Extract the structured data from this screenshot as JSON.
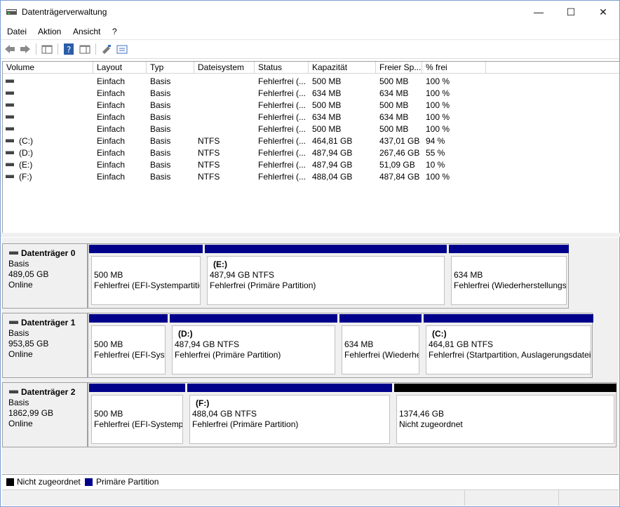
{
  "window": {
    "title": "Datenträgerverwaltung",
    "minimize": "—",
    "maximize": "☐",
    "close": "✕"
  },
  "menu": [
    "Datei",
    "Aktion",
    "Ansicht",
    "?"
  ],
  "columns": [
    "Volume",
    "Layout",
    "Typ",
    "Dateisystem",
    "Status",
    "Kapazität",
    "Freier Sp...",
    "% frei"
  ],
  "volumes": [
    {
      "name": "",
      "layout": "Einfach",
      "typ": "Basis",
      "fs": "",
      "status": "Fehlerfrei (...",
      "cap": "500 MB",
      "free": "500 MB",
      "pct": "100 %"
    },
    {
      "name": "",
      "layout": "Einfach",
      "typ": "Basis",
      "fs": "",
      "status": "Fehlerfrei (...",
      "cap": "634 MB",
      "free": "634 MB",
      "pct": "100 %"
    },
    {
      "name": "",
      "layout": "Einfach",
      "typ": "Basis",
      "fs": "",
      "status": "Fehlerfrei (...",
      "cap": "500 MB",
      "free": "500 MB",
      "pct": "100 %"
    },
    {
      "name": "",
      "layout": "Einfach",
      "typ": "Basis",
      "fs": "",
      "status": "Fehlerfrei (...",
      "cap": "634 MB",
      "free": "634 MB",
      "pct": "100 %"
    },
    {
      "name": "",
      "layout": "Einfach",
      "typ": "Basis",
      "fs": "",
      "status": "Fehlerfrei (...",
      "cap": "500 MB",
      "free": "500 MB",
      "pct": "100 %"
    },
    {
      "name": "(C:)",
      "layout": "Einfach",
      "typ": "Basis",
      "fs": "NTFS",
      "status": "Fehlerfrei (...",
      "cap": "464,81 GB",
      "free": "437,01 GB",
      "pct": "94 %"
    },
    {
      "name": "(D:)",
      "layout": "Einfach",
      "typ": "Basis",
      "fs": "NTFS",
      "status": "Fehlerfrei (...",
      "cap": "487,94 GB",
      "free": "267,46 GB",
      "pct": "55 %"
    },
    {
      "name": "(E:)",
      "layout": "Einfach",
      "typ": "Basis",
      "fs": "NTFS",
      "status": "Fehlerfrei (...",
      "cap": "487,94 GB",
      "free": "51,09 GB",
      "pct": "10 %"
    },
    {
      "name": "(F:)",
      "layout": "Einfach",
      "typ": "Basis",
      "fs": "NTFS",
      "status": "Fehlerfrei (...",
      "cap": "488,04 GB",
      "free": "487,84 GB",
      "pct": "100 %"
    }
  ],
  "disks": [
    {
      "name": "Datenträger 0",
      "type": "Basis",
      "size": "489,05 GB",
      "state": "Online",
      "parts": [
        {
          "label": "",
          "size": "500 MB",
          "status": "Fehlerfrei (EFI-Systempartition)",
          "kind": "primary"
        },
        {
          "label": "(E:)",
          "size": "487,94 GB NTFS",
          "status": "Fehlerfrei (Primäre Partition)",
          "kind": "primary"
        },
        {
          "label": "",
          "size": "634 MB",
          "status": "Fehlerfrei (Wiederherstellungspartition)",
          "kind": "primary"
        }
      ]
    },
    {
      "name": "Datenträger 1",
      "type": "Basis",
      "size": "953,85 GB",
      "state": "Online",
      "parts": [
        {
          "label": "",
          "size": "500 MB",
          "status": "Fehlerfrei (EFI-Systempartition)",
          "kind": "primary"
        },
        {
          "label": "(D:)",
          "size": "487,94 GB NTFS",
          "status": "Fehlerfrei (Primäre Partition)",
          "kind": "primary"
        },
        {
          "label": "",
          "size": "634 MB",
          "status": "Fehlerfrei (Wiederherstellungspartition)",
          "kind": "primary"
        },
        {
          "label": "(C:)",
          "size": "464,81 GB NTFS",
          "status": "Fehlerfrei (Startpartition, Auslagerungsdatei, Absturzabbild, Primäre Partition)",
          "kind": "primary"
        }
      ]
    },
    {
      "name": "Datenträger 2",
      "type": "Basis",
      "size": "1862,99 GB",
      "state": "Online",
      "parts": [
        {
          "label": "",
          "size": "500 MB",
          "status": "Fehlerfrei (EFI-Systempartition)",
          "kind": "primary"
        },
        {
          "label": "(F:)",
          "size": "488,04 GB NTFS",
          "status": "Fehlerfrei (Primäre Partition)",
          "kind": "primary"
        },
        {
          "label": "",
          "size": "1374,46 GB",
          "status": "Nicht zugeordnet",
          "kind": "unallocated"
        }
      ]
    }
  ],
  "legend": [
    {
      "label": "Nicht zugeordnet",
      "color": "#000000"
    },
    {
      "label": "Primäre Partition",
      "color": "#00008b"
    }
  ],
  "colors": {
    "primary": "#00008b",
    "unallocated": "#000000"
  }
}
